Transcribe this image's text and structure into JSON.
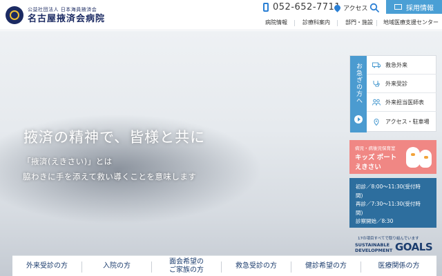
{
  "header": {
    "logo_sub": "公益社団法人 日本海員掖済会",
    "logo_main": "名古屋掖済会病院",
    "phone": "052-652-7711",
    "access": "アクセス",
    "recruit": "採用情報",
    "nav": [
      "病院情報",
      "診療科案内",
      "部門・施設",
      "地域医療支援センター"
    ]
  },
  "hero": {
    "title": "掖済の精神で、皆様と共に",
    "line1": "「掖済(えきさい)」とは",
    "line2": "脇わきに手を添えて救い導くことを意味します"
  },
  "urgent": {
    "label": "お急ぎの方へ",
    "items": [
      "救急外来",
      "外来受診",
      "外来担当医師表",
      "アクセス・駐車場"
    ]
  },
  "kids": {
    "sub": "病児・病後児保育室",
    "title": "キッズ ポート",
    "name": "えきさい"
  },
  "hours": {
    "lines": [
      "初診／8:00～11:30(受付時",
      "間)",
      "再診／7:30～11:30(受付時",
      "間)",
      "診察開始／8:30"
    ]
  },
  "sdgs": {
    "caption": "17の項目すべてで取り組んでいます",
    "line1": "SUSTAINABLE",
    "line2": "DEVELOPMENT",
    "goals": "GOALS"
  },
  "tabs": [
    {
      "label": "外来受診の方"
    },
    {
      "label": "入院の方"
    },
    {
      "label": "面会希望の\nご家族の方"
    },
    {
      "label": "救急受診の方"
    },
    {
      "label": "健診希望の方"
    },
    {
      "label": "医療関係の方"
    }
  ],
  "colors": {
    "brand_navy": "#1c2b63",
    "accent_blue": "#4a9fd5",
    "hours_blue": "#2d6e9e",
    "kids_pink": "#f08784"
  }
}
